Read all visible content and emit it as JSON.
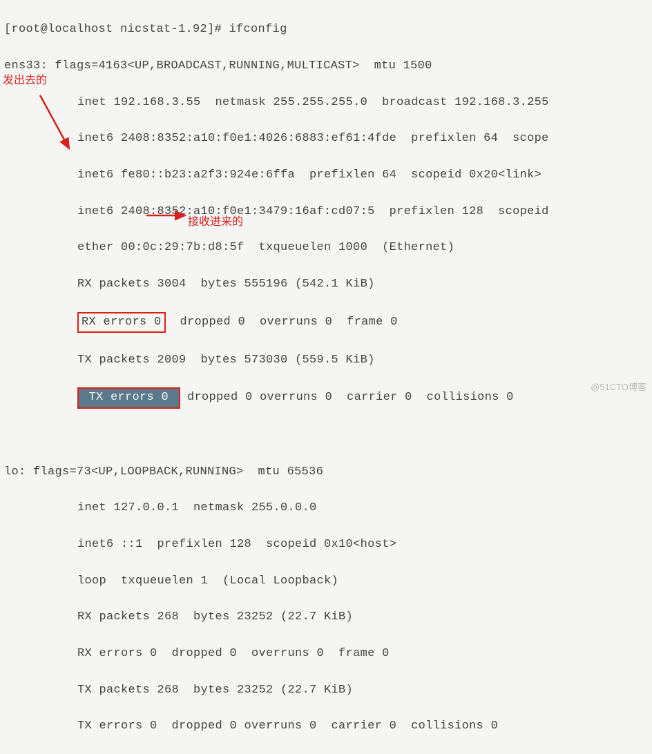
{
  "prompt": "[root@localhost nicstat-1.92]# ifconfig",
  "ens33": {
    "header": "ens33: flags=4163<UP,BROADCAST,RUNNING,MULTICAST>  mtu 1500",
    "inet": "inet 192.168.3.55  netmask 255.255.255.0  broadcast 192.168.3.255",
    "inet6_1": "inet6 2408:8352:a10:f0e1:4026:6883:ef61:4fde  prefixlen 64  scope",
    "inet6_2": "inet6 fe80::b23:a2f3:924e:6ffa  prefixlen 64  scopeid 0x20<link>",
    "inet6_3": "inet6 2408:8352:a10:f0e1:3479:16af:cd07:5  prefixlen 128  scopeid",
    "ether": "ether 00:0c:29:7b:d8:5f  txqueuelen 1000  (Ethernet)",
    "rx_packets": "RX packets 3004  bytes 555196 (542.1 KiB)",
    "rx_errors_label": "RX errors 0",
    "rx_errors_rest": "  dropped 0  overruns 0  frame 0",
    "tx_packets": "TX packets 2009  bytes 573030 (559.5 KiB)",
    "tx_errors_label": " TX errors 0 ",
    "tx_errors_rest": " dropped 0 overruns 0  carrier 0  collisions 0"
  },
  "lo": {
    "header": "lo: flags=73<UP,LOOPBACK,RUNNING>  mtu 65536",
    "inet": "inet 127.0.0.1  netmask 255.0.0.0",
    "inet6": "inet6 ::1  prefixlen 128  scopeid 0x10<host>",
    "loop": "loop  txqueuelen 1  (Local Loopback)",
    "rx_packets": "RX packets 268  bytes 23252 (22.7 KiB)",
    "rx_errors": "RX errors 0  dropped 0  overruns 0  frame 0",
    "tx_packets": "TX packets 268  bytes 23252 (22.7 KiB)",
    "tx_errors": "TX errors 0  dropped 0 overruns 0  carrier 0  collisions 0"
  },
  "annotations": {
    "outgoing": "发出去的",
    "incoming": "接收进来的"
  },
  "watermark": "@51CTO博客"
}
